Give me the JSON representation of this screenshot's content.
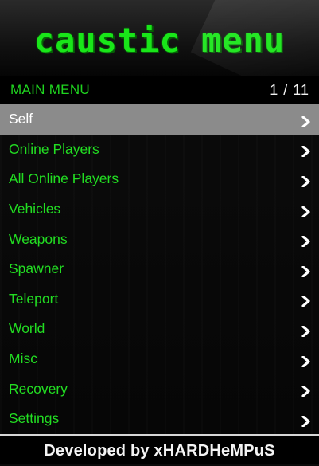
{
  "header": {
    "title": "caustic menu"
  },
  "subheader": {
    "title": "MAIN MENU",
    "page_indicator": "1 / 11"
  },
  "menu_items": [
    {
      "label": "Self",
      "selected": true,
      "icon": "chevron-right-icon"
    },
    {
      "label": "Online Players",
      "icon": "chevron-right-icon"
    },
    {
      "label": "All Online Players",
      "icon": "chevron-right-icon"
    },
    {
      "label": "Vehicles",
      "icon": "chevron-right-icon"
    },
    {
      "label": "Weapons",
      "icon": "chevron-right-icon"
    },
    {
      "label": "Spawner",
      "icon": "chevron-right-icon"
    },
    {
      "label": "Teleport",
      "icon": "chevron-right-icon"
    },
    {
      "label": "World",
      "icon": "chevron-right-icon"
    },
    {
      "label": "Misc",
      "icon": "chevron-right-icon"
    },
    {
      "label": "Recovery",
      "icon": "chevron-right-icon"
    },
    {
      "label": "Settings",
      "icon": "chevron-right-icon"
    }
  ],
  "footer": {
    "credit": "Developed by xHARDHeMPuS"
  },
  "colors": {
    "accent_green": "#22dd22",
    "selected_bg": "#8b8b8b",
    "text_white": "#ffffff"
  }
}
